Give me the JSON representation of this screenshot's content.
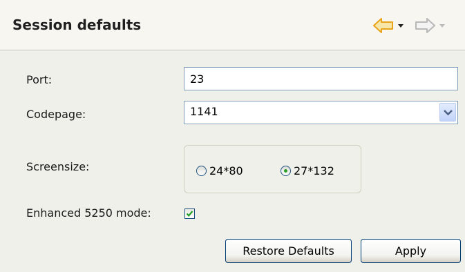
{
  "header": {
    "title": "Session defaults",
    "back_icon": "back-arrow-icon",
    "forward_icon": "forward-arrow-icon",
    "back_color": "#e8a317",
    "forward_color": "#b8b8b8"
  },
  "form": {
    "port": {
      "label": "Port:",
      "value": "23"
    },
    "codepage": {
      "label": "Codepage:",
      "value": "1141"
    },
    "screensize": {
      "label": "Screensize:",
      "options": [
        {
          "label": "24*80",
          "selected": false
        },
        {
          "label": "27*132",
          "selected": true
        }
      ]
    },
    "enhanced_mode": {
      "label": "Enhanced 5250 mode:",
      "checked": true
    }
  },
  "buttons": {
    "restore_defaults": "Restore Defaults",
    "apply": "Apply"
  }
}
